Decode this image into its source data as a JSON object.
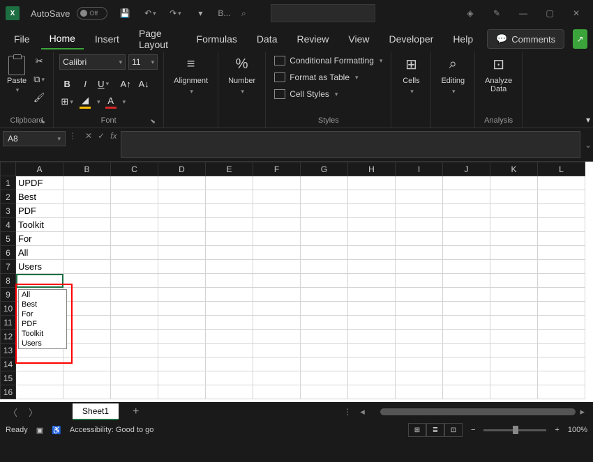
{
  "titlebar": {
    "autosave_label": "AutoSave",
    "autosave_state": "Off",
    "filename": "B..."
  },
  "tabs": {
    "file": "File",
    "home": "Home",
    "insert": "Insert",
    "page_layout": "Page Layout",
    "formulas": "Formulas",
    "data": "Data",
    "review": "Review",
    "view": "View",
    "developer": "Developer",
    "help": "Help",
    "comments": "Comments"
  },
  "ribbon": {
    "paste": "Paste",
    "clipboard": "Clipboard",
    "font_name": "Calibri",
    "font_size": "11",
    "font": "Font",
    "alignment": "Alignment",
    "number": "Number",
    "cond_fmt": "Conditional Formatting",
    "fmt_table": "Format as Table",
    "cell_styles": "Cell Styles",
    "styles": "Styles",
    "cells": "Cells",
    "editing": "Editing",
    "analyze_data": "Analyze Data",
    "analysis": "Analysis"
  },
  "formula_bar": {
    "cell_ref": "A8",
    "fx": "fx"
  },
  "columns": [
    "A",
    "B",
    "C",
    "D",
    "E",
    "F",
    "G",
    "H",
    "I",
    "J",
    "K",
    "L"
  ],
  "rows": [
    "1",
    "2",
    "3",
    "4",
    "5",
    "6",
    "7",
    "8",
    "9",
    "10",
    "11",
    "12",
    "13",
    "14",
    "15",
    "16"
  ],
  "cells": {
    "A1": "UPDF",
    "A2": "Best",
    "A3": "PDF",
    "A4": "Toolkit",
    "A5": "For",
    "A6": "All",
    "A7": "Users"
  },
  "selected_cell": "A8",
  "dropdown": [
    "All",
    "Best",
    "For",
    "PDF",
    "Toolkit",
    "Users"
  ],
  "sheet_tabs": {
    "active": "Sheet1"
  },
  "status": {
    "ready": "Ready",
    "accessibility": "Accessibility: Good to go",
    "zoom": "100%"
  }
}
